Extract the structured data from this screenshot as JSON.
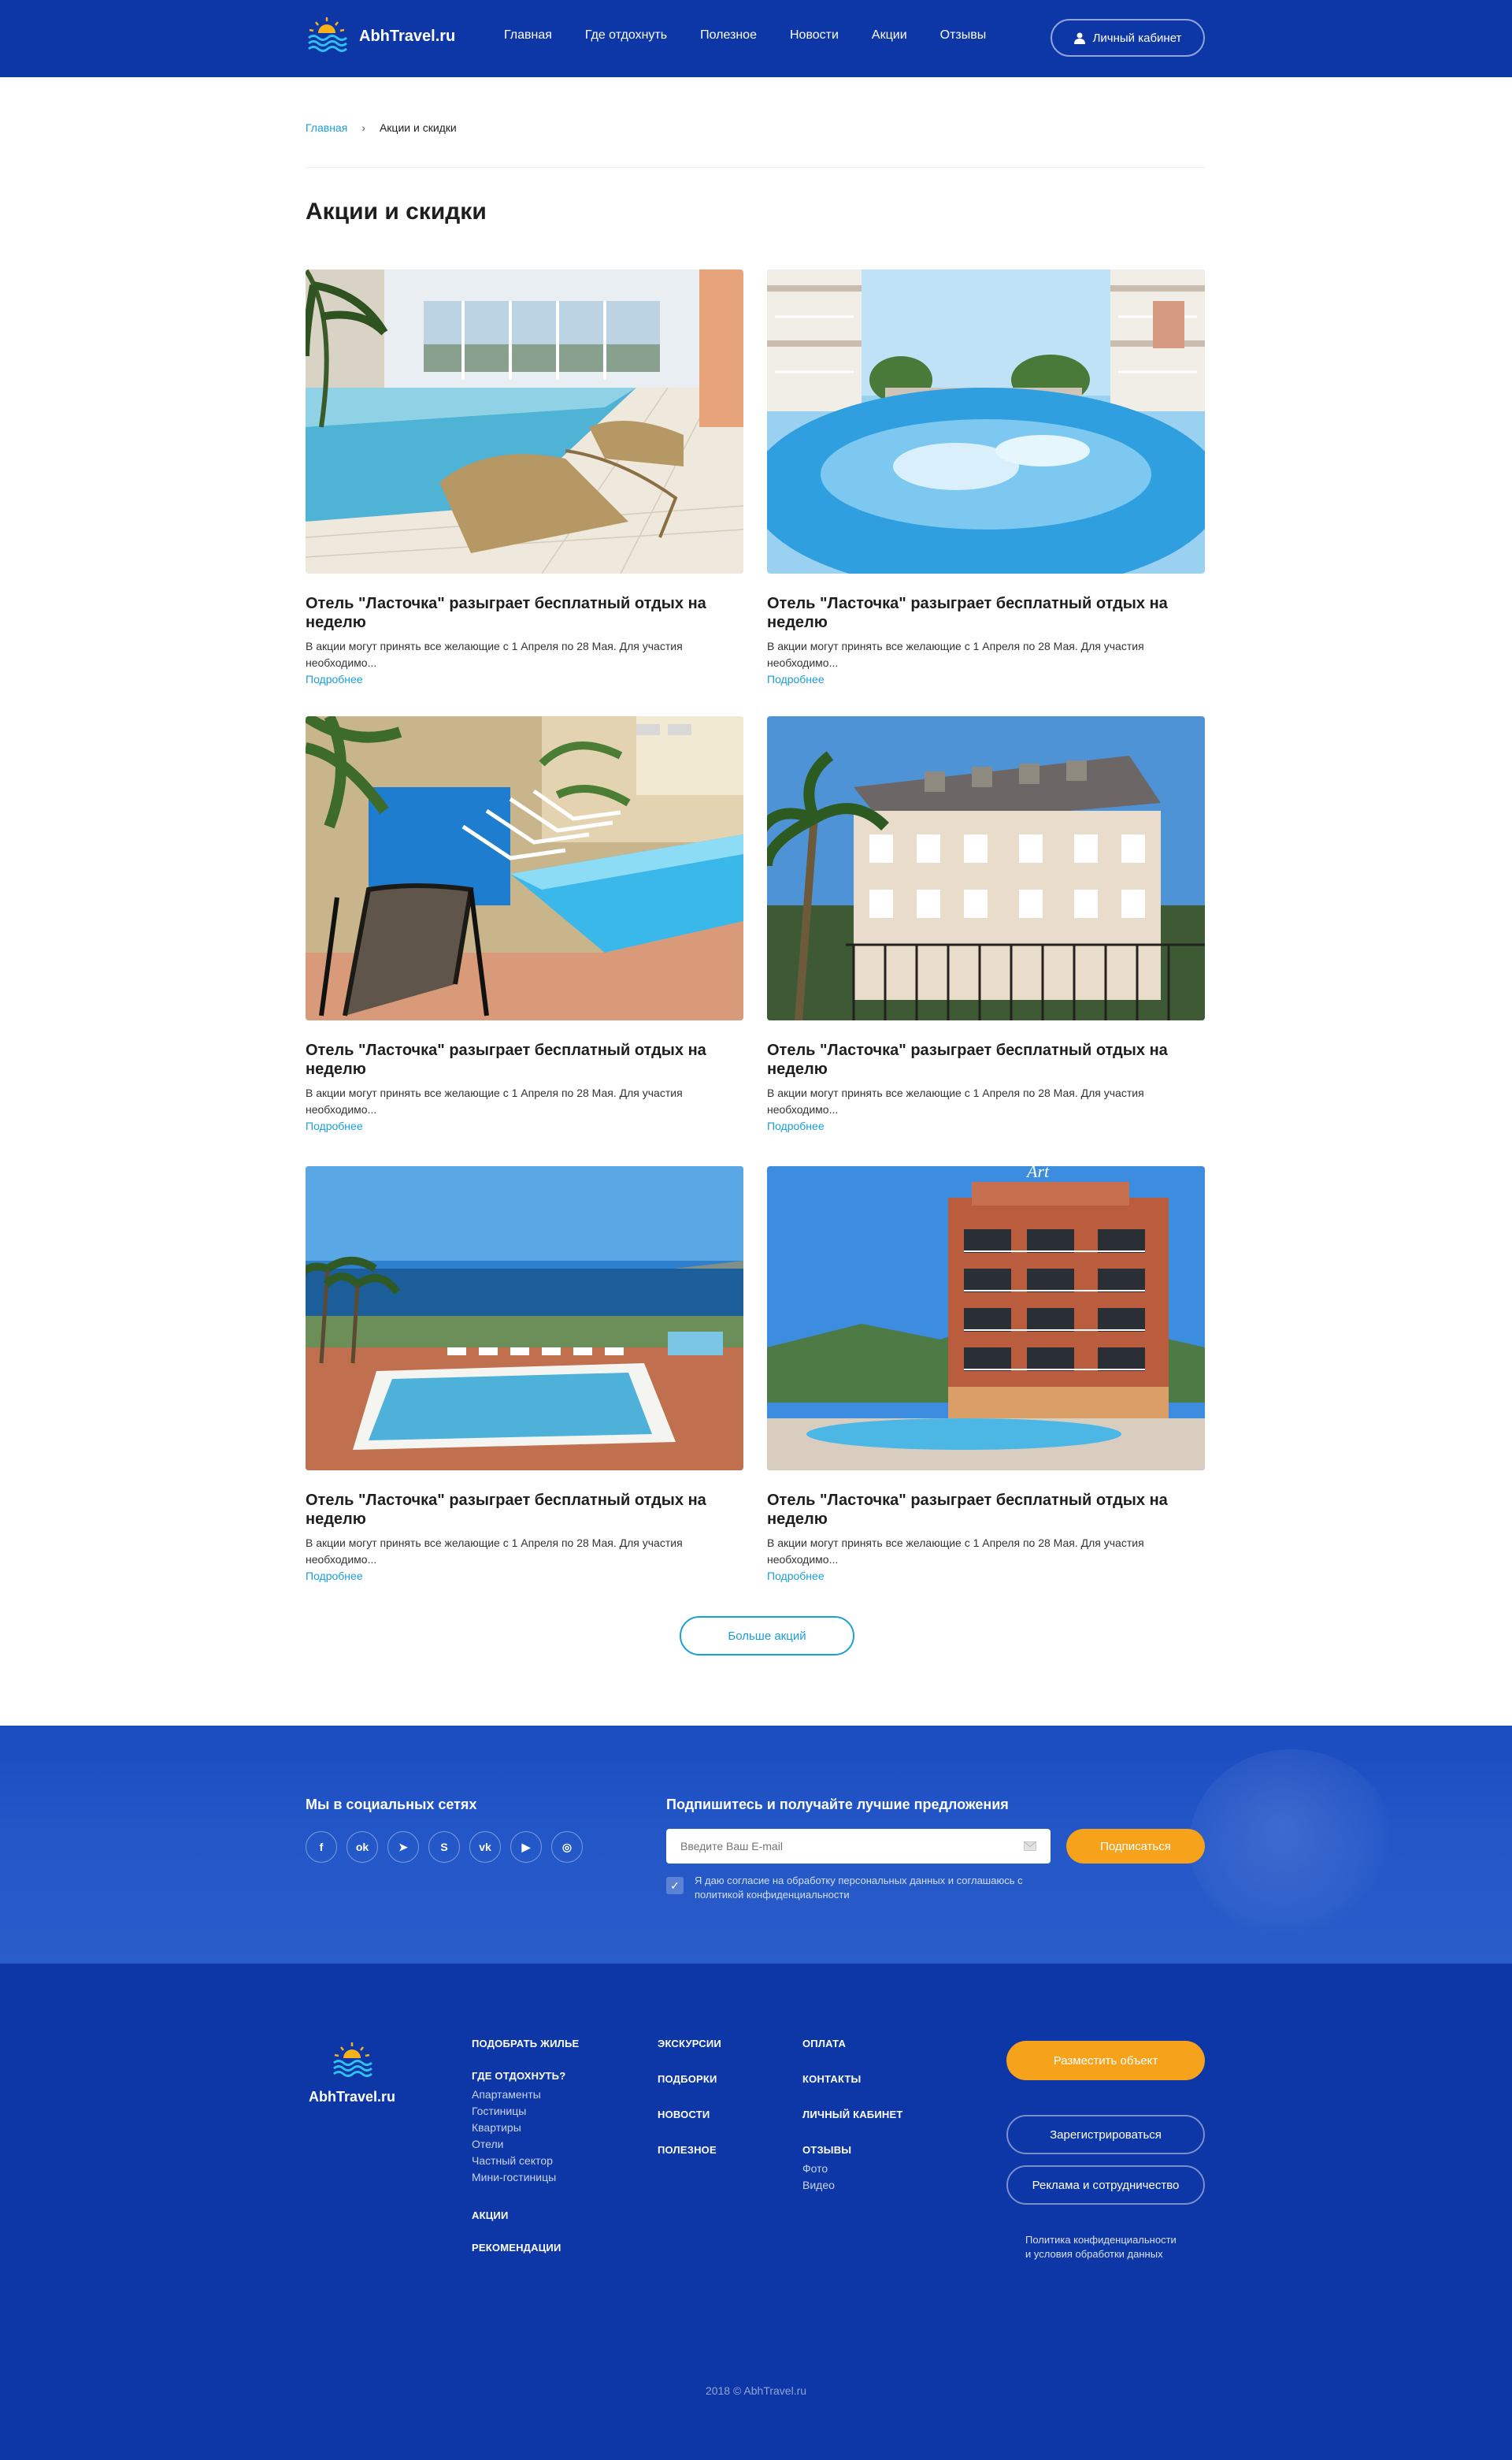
{
  "header": {
    "logo_text": "AbhTravel.ru",
    "nav": [
      "Главная",
      "Где отдохнуть",
      "Полезное",
      "Новости",
      "Акции",
      "Отзывы"
    ],
    "cabinet_label": "Личный кабинет"
  },
  "breadcrumb": {
    "home": "Главная",
    "current": "Акции и скидки"
  },
  "page_title": "Акции и скидки",
  "cards": [
    {
      "title": "Отель \"Ласточка\" разыграет бесплатный отдых на неделю",
      "desc": "В акции могут принять все желающие с 1 Апреля по 28 Мая. Для участия необходимо...",
      "more": "Подробнее",
      "image": "indoor-pool"
    },
    {
      "title": "Отель \"Ласточка\" разыграет бесплатный отдых на неделю",
      "desc": "В акции могут принять все желающие с 1 Апреля по 28 Мая. Для участия необходимо...",
      "more": "Подробнее",
      "image": "outdoor-pool-balconies"
    },
    {
      "title": "Отель \"Ласточка\" разыграет бесплатный отдых на неделю",
      "desc": "В акции могут принять все желающие с 1 Апреля по 28 Мая. Для участия необходимо...",
      "more": "Подробнее",
      "image": "pool-loungers-palms"
    },
    {
      "title": "Отель \"Ласточка\" разыграет бесплатный отдых на неделю",
      "desc": "В акции могут принять все желающие с 1 Апреля по 28 Мая. Для участия необходимо...",
      "more": "Подробнее",
      "image": "hotel-facade"
    },
    {
      "title": "Отель \"Ласточка\" разыграет бесплатный отдых на неделю",
      "desc": "В акции могут принять все желающие с 1 Апреля по 28 Мая. Для участия необходимо...",
      "more": "Подробнее",
      "image": "seaside-pool"
    },
    {
      "title": "Отель \"Ласточка\" разыграет бесплатный отдых на неделю",
      "desc": "В акции могут принять все желающие с 1 Апреля по 28 Мая. Для участия необходимо...",
      "more": "Подробнее",
      "image": "hotel-tower-pool"
    }
  ],
  "more_button": "Больше акций",
  "subscribe": {
    "social_title": "Мы в социальных сетях",
    "socials": [
      {
        "name": "facebook-icon",
        "glyph": "f"
      },
      {
        "name": "odnoklassniki-icon",
        "glyph": "ok"
      },
      {
        "name": "telegram-icon",
        "glyph": "➤"
      },
      {
        "name": "skype-icon",
        "glyph": "S"
      },
      {
        "name": "vk-icon",
        "glyph": "vk"
      },
      {
        "name": "youtube-icon",
        "glyph": "▶"
      },
      {
        "name": "instagram-icon",
        "glyph": "◎"
      }
    ],
    "title": "Подпишитесь и получайте лучшие предложения",
    "email_placeholder": "Введите Ваш E-mail",
    "button": "Подписаться",
    "consent": "Я даю согласие на обработку персональных данных и соглашаюсь с политикой конфиденциальности"
  },
  "footer": {
    "logo_text": "AbhTravel.ru",
    "col1": {
      "head1": "Подобрать жилье",
      "head2": "Где отдохнуть?",
      "links": [
        "Апартаменты",
        "Гостиницы",
        "Квартиры",
        "Отели",
        "Частный сектор",
        "Мини-гостиницы"
      ],
      "head3": "Акции",
      "head4": "Рекомендации"
    },
    "col2": [
      "Экскурсии",
      "Подборки",
      "Новости",
      "Полезное"
    ],
    "col3": {
      "heads": [
        "Оплата",
        "Контакты",
        "Личный кабинет",
        "Отзывы"
      ],
      "links": [
        "Фото",
        "Видео"
      ]
    },
    "btn_place": "Разместить объект",
    "btn_register": "Зарегистрироваться",
    "btn_ads": "Реклама и сотрудничество",
    "policy": "Политика конфиденциальности\nи условия обработки данных",
    "copyright": "2018 © AbhTravel.ru"
  },
  "colors": {
    "primary": "#0d36a6",
    "accent": "#1a9fd6",
    "orange": "#f7a21b"
  }
}
